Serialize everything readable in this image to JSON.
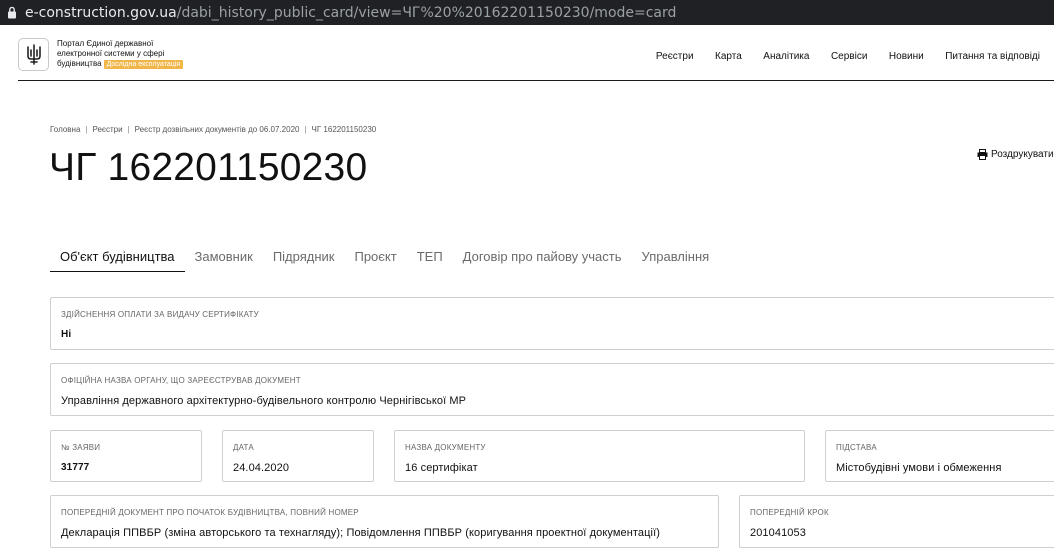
{
  "browser": {
    "url_host": "e-construction.gov.ua",
    "url_path": "/dabi_history_public_card/view=ЧГ%20%20162201150230/mode=card"
  },
  "header": {
    "brand_line1": "Портал Єдиної державної",
    "brand_line2": "електронної системи у сфері",
    "brand_line3": "будівництва",
    "beta_badge": "Дослідна експлуатація",
    "nav": [
      "Реєстри",
      "Карта",
      "Аналітика",
      "Сервіси",
      "Новини",
      "Питання та відповіді"
    ],
    "beta_color": "#f0b64a"
  },
  "breadcrumb": [
    "Головна",
    "Реєстри",
    "Реєстр дозвільних документів до 06.07.2020",
    "ЧГ 162201150230"
  ],
  "page_title": "ЧГ 162201150230",
  "print_label": "Роздрукувати",
  "tabs": [
    "Об'єкт будівництва",
    "Замовник",
    "Підрядник",
    "Проєкт",
    "ТЕП",
    "Договір про пайову участь",
    "Управління"
  ],
  "active_tab": "Об'єкт будівництва",
  "fields": {
    "payment": {
      "label": "Здійснення оплати за видачу сертифікату",
      "value": "Ні"
    },
    "organ": {
      "label": "Офіційна назва органу, що зареєстрував документ",
      "value": "Управління державного архітектурно-будівельного контролю Чернігівської МР"
    },
    "app_number": {
      "label": "№ заяви",
      "value": "31777"
    },
    "date": {
      "label": "Дата",
      "value": "24.04.2020"
    },
    "doc_name": {
      "label": "Назва документу",
      "value": "16 сертифікат"
    },
    "basis": {
      "label": "Підстава",
      "value": "Містобудівні умови і обмеження"
    },
    "prev_doc": {
      "label": "Попередній документ про початок будівництва, повний номер",
      "value": "Декларація ППВБР (зміна авторського та технагляду); Повідомлення ППВБР (коригування проектної документації)"
    },
    "prev_step": {
      "label": "Попередній крок",
      "value": "201041053"
    }
  }
}
